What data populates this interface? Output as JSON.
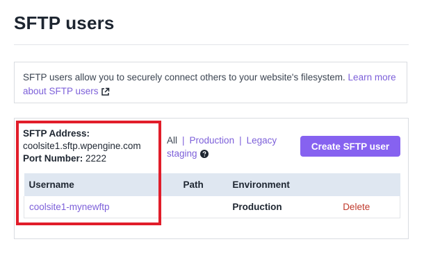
{
  "page": {
    "title": "SFTP users"
  },
  "info": {
    "text": "SFTP users allow you to securely connect others to your website's filesystem.",
    "link_text": "Learn more about SFTP users",
    "link_icon": "external-link-icon"
  },
  "sftp": {
    "address_label": "SFTP Address:",
    "address_value": "coolsite1.sftp.wpengine.com",
    "port_label": "Port Number:",
    "port_value": "2222"
  },
  "filters": {
    "all": "All",
    "production": "Production",
    "legacy_staging": "Legacy staging",
    "separator": "|",
    "help_icon": "question-circle-icon"
  },
  "actions": {
    "create_label": "Create SFTP user"
  },
  "table": {
    "headers": {
      "username": "Username",
      "path": "Path",
      "environment": "Environment",
      "actions": ""
    },
    "rows": [
      {
        "username": "coolsite1-mynewftp",
        "path": "",
        "environment": "Production",
        "delete": "Delete"
      }
    ]
  },
  "colors": {
    "accent": "#8662f0",
    "link": "#7c5fd9",
    "delete": "#c0392b",
    "highlight": "#e11d2a",
    "table_header_bg": "#dfe7f1"
  }
}
